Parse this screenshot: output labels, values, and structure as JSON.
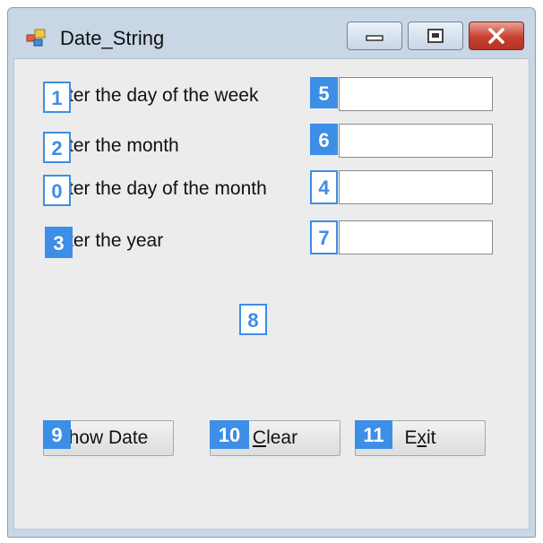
{
  "window": {
    "title": "Date_String",
    "buttons": {
      "minimize_icon": "minimize-icon",
      "maximize_icon": "restore-icon",
      "close_icon": "close-icon"
    }
  },
  "form": {
    "labels": [
      {
        "text": "ter the day of the week",
        "marker": "1"
      },
      {
        "text": "ter the month",
        "marker": "2"
      },
      {
        "text": "ter the day of the month",
        "marker": "0"
      },
      {
        "text": "ter the year",
        "marker": "3"
      }
    ],
    "inputs": [
      {
        "marker": "5",
        "value": ""
      },
      {
        "marker": "6",
        "value": ""
      },
      {
        "marker": "4",
        "value": ""
      },
      {
        "marker": "7",
        "value": ""
      }
    ],
    "output_label": {
      "marker": "8",
      "text": ""
    },
    "buttons": {
      "show_date": {
        "label": "how Date",
        "marker": "9"
      },
      "clear": {
        "label_first": "C",
        "label_rest": "lear",
        "marker": "10"
      },
      "exit": {
        "label_first": "E",
        "label_mid": "x",
        "label_rest": "it",
        "marker": "11"
      }
    }
  },
  "colors": {
    "marker_blue": "#3c8ee6",
    "close_red": "#c8412f",
    "client_bg": "#ececec",
    "frame_bg": "#c8d6e6"
  }
}
